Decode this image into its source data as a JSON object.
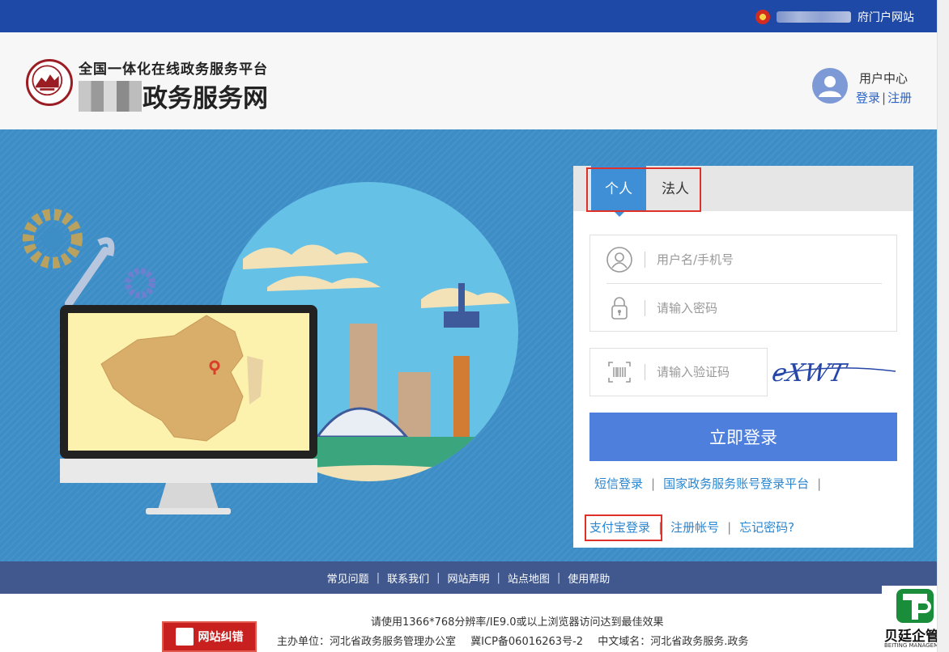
{
  "topbar": {
    "portal_link": "府门户网站"
  },
  "header": {
    "subtitle": "全国一体化在线政务服务平台",
    "title_suffix": "政务服务网",
    "user_center": "用户中心",
    "login_link": "登录",
    "separator": "|",
    "register_link": "注册"
  },
  "login": {
    "tabs": [
      {
        "label": "个人",
        "active": true
      },
      {
        "label": "法人",
        "active": false
      }
    ],
    "username_placeholder": "用户名/手机号",
    "password_placeholder": "请输入密码",
    "captcha_placeholder": "请输入验证码",
    "captcha_text": "eXWT",
    "submit_label": "立即登录",
    "links_row1": [
      "短信登录",
      "国家政务服务账号登录平台"
    ],
    "links_row2": [
      "支付宝登录",
      "注册帐号",
      "忘记密码?"
    ],
    "link_separator": "|"
  },
  "footer": {
    "nav": [
      "常见问题",
      "联系我们",
      "网站声明",
      "站点地图",
      "使用帮助"
    ],
    "nav_separator": "|",
    "tip": "请使用1366*768分辨率/IE9.0或以上浏览器访问达到最佳效果",
    "host": "主办单位：河北省政务服务管理办公室",
    "icp": "冀ICP备06016263号-2",
    "domain": "中文域名：河北省政务服务.政务",
    "correct_button": "网站纠错"
  },
  "watermark": {
    "name": "贝廷企管",
    "english": "BEITING MANAGEMENT"
  },
  "colors": {
    "topbar": "#1e49a6",
    "banner": "#3d8dc6",
    "active_tab": "#3f8fd6",
    "login_button": "#4f7fdc",
    "link": "#2a86d0",
    "footer_nav": "#40588e",
    "highlight_box": "#e0302a"
  },
  "icons": [
    "gov-emblem-icon",
    "site-seal-logo",
    "user-avatar-icon",
    "user-icon",
    "lock-icon",
    "barcode-icon"
  ]
}
